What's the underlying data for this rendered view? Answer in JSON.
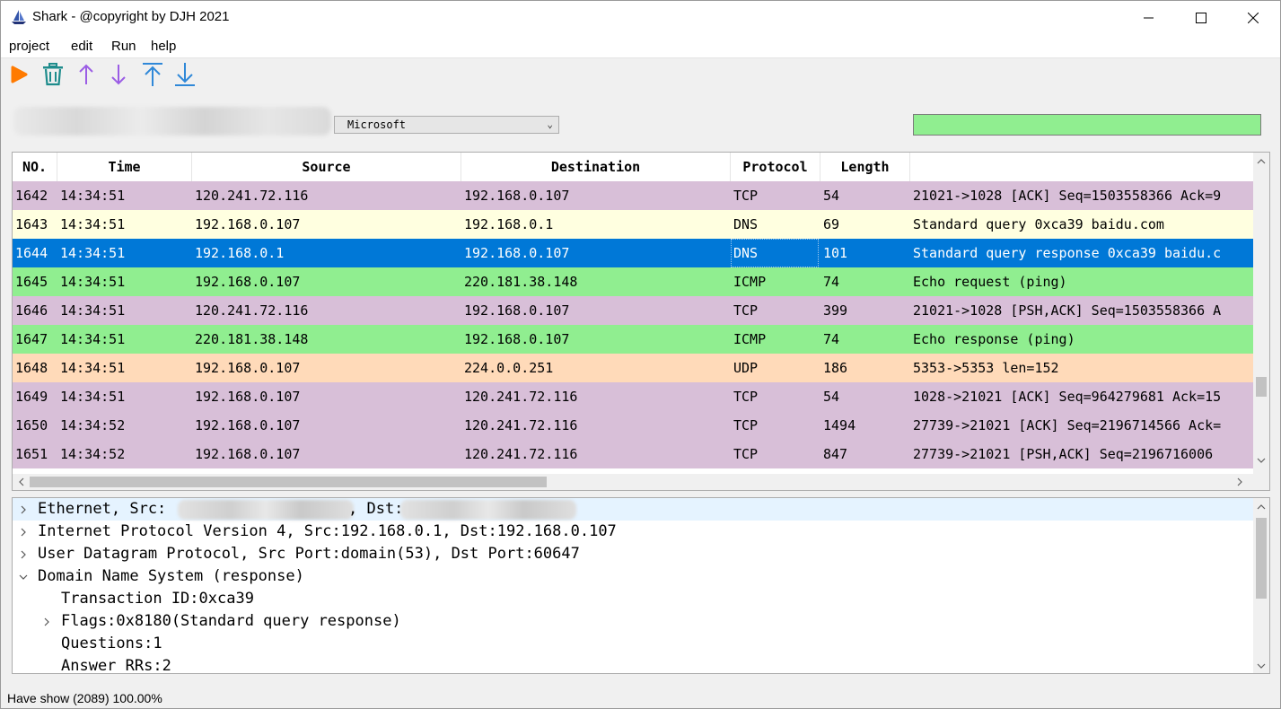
{
  "window": {
    "title": "Shark - @copyright by DJH 2021",
    "icons": [
      "app-sailboat-icon",
      "minimize-icon",
      "maximize-icon",
      "close-icon"
    ]
  },
  "menu": [
    "project",
    "edit",
    "Run",
    "help"
  ],
  "toolbar": {
    "icons": [
      "start-capture-icon",
      "trash-icon",
      "scroll-up-icon",
      "scroll-down-icon",
      "scroll-top-icon",
      "scroll-bottom-icon"
    ],
    "colors": {
      "start": "#ff7a00",
      "trash": "#1e8c8c",
      "updown": "#9b5de5",
      "topbottom": "#2f88d8"
    }
  },
  "filter": {
    "interface_selected": "Microsoft",
    "filter_bg": "#90ee90"
  },
  "packet_list": {
    "columns": [
      "NO.",
      "Time",
      "Source",
      "Destination",
      "Protocol",
      "Length",
      ""
    ],
    "rows": [
      {
        "no": "1642",
        "time": "14:34:51",
        "src": "120.241.72.116",
        "dst": "192.168.0.107",
        "proto": "TCP",
        "len": "54",
        "info": "21021->1028 [ACK] Seq=1503558366 Ack=9",
        "bg": "#d8bfd8"
      },
      {
        "no": "1643",
        "time": "14:34:51",
        "src": "192.168.0.107",
        "dst": "192.168.0.1",
        "proto": "DNS",
        "len": "69",
        "info": "Standard query 0xca39 baidu.com",
        "bg": "#ffffe0"
      },
      {
        "no": "1644",
        "time": "14:34:51",
        "src": "192.168.0.1",
        "dst": "192.168.0.107",
        "proto": "DNS",
        "len": "101",
        "info": "Standard query response 0xca39 baidu.c",
        "bg": "#0078d7",
        "selected": true
      },
      {
        "no": "1645",
        "time": "14:34:51",
        "src": "192.168.0.107",
        "dst": "220.181.38.148",
        "proto": "ICMP",
        "len": "74",
        "info": "Echo request (ping)",
        "bg": "#90ee90"
      },
      {
        "no": "1646",
        "time": "14:34:51",
        "src": "120.241.72.116",
        "dst": "192.168.0.107",
        "proto": "TCP",
        "len": "399",
        "info": "21021->1028 [PSH,ACK] Seq=1503558366 A",
        "bg": "#d8bfd8"
      },
      {
        "no": "1647",
        "time": "14:34:51",
        "src": "220.181.38.148",
        "dst": "192.168.0.107",
        "proto": "ICMP",
        "len": "74",
        "info": "Echo response (ping)",
        "bg": "#90ee90"
      },
      {
        "no": "1648",
        "time": "14:34:51",
        "src": "192.168.0.107",
        "dst": "224.0.0.251",
        "proto": "UDP",
        "len": "186",
        "info": "5353->5353 len=152",
        "bg": "#ffdab9"
      },
      {
        "no": "1649",
        "time": "14:34:51",
        "src": "192.168.0.107",
        "dst": "120.241.72.116",
        "proto": "TCP",
        "len": "54",
        "info": "1028->21021 [ACK] Seq=964279681 Ack=15",
        "bg": "#d8bfd8"
      },
      {
        "no": "1650",
        "time": "14:34:52",
        "src": "192.168.0.107",
        "dst": "120.241.72.116",
        "proto": "TCP",
        "len": "1494",
        "info": "27739->21021 [ACK] Seq=2196714566 Ack=",
        "bg": "#d8bfd8"
      },
      {
        "no": "1651",
        "time": "14:34:52",
        "src": "192.168.0.107",
        "dst": "120.241.72.116",
        "proto": "TCP",
        "len": "847",
        "info": "27739->21021 [PSH,ACK] Seq=2196716006 ",
        "bg": "#d8bfd8"
      }
    ]
  },
  "detail": {
    "lines": [
      {
        "text": "Ethernet, Src:",
        "text2": ", Dst:",
        "expander": "collapsed",
        "indent": 0
      },
      {
        "text": "Internet Protocol Version 4, Src:192.168.0.1, Dst:192.168.0.107",
        "expander": "collapsed",
        "indent": 0
      },
      {
        "text": "User Datagram Protocol, Src Port:domain(53), Dst Port:60647",
        "expander": "collapsed",
        "indent": 0
      },
      {
        "text": "Domain Name System (response)",
        "expander": "expanded",
        "indent": 0
      },
      {
        "text": "Transaction ID:0xca39",
        "expander": "none",
        "indent": 1
      },
      {
        "text": "Flags:0x8180(Standard query response)",
        "expander": "collapsed",
        "indent": 1
      },
      {
        "text": "Questions:1",
        "expander": "none",
        "indent": 1
      },
      {
        "text": "Answer RRs:2",
        "expander": "none",
        "indent": 1
      }
    ]
  },
  "status": {
    "text": "Have show (2089) 100.00%"
  }
}
